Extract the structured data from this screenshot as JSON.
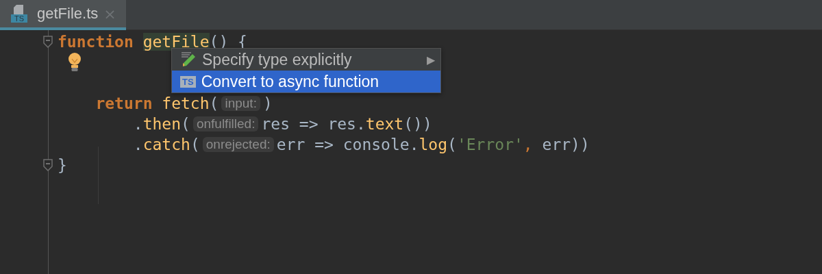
{
  "tabs": [
    {
      "label": "getFile.ts",
      "selected": true,
      "close": "×",
      "icon_text": "TS"
    }
  ],
  "code_lines": [
    {
      "fold": true,
      "tokens": [
        {
          "kind": "keyword",
          "text": "function"
        },
        {
          "kind": "fn-decl",
          "text": "getFile"
        },
        {
          "kind": "plain",
          "text": "() {"
        }
      ],
      "children": [
        {
          "kind": "blank",
          "bulb": true
        },
        {
          "kind": "blank"
        },
        {
          "tokens": [
            {
              "kind": "keyword",
              "text": "return"
            },
            {
              "kind": "fn",
              "text": "fetch"
            },
            {
              "kind": "plain",
              "text": "("
            },
            {
              "kind": "hint",
              "text": "input:"
            },
            {
              "kind": "plain",
              "text": ")"
            }
          ],
          "children": [
            {
              "tokens": [
                {
                  "kind": "plain",
                  "text": "."
                },
                {
                  "kind": "fn",
                  "text": "then"
                },
                {
                  "kind": "plain",
                  "text": "("
                },
                {
                  "kind": "hint",
                  "text": "onfulfilled:"
                },
                {
                  "kind": "plain",
                  "text": "res => res."
                },
                {
                  "kind": "fn",
                  "text": "text"
                },
                {
                  "kind": "plain",
                  "text": "())"
                }
              ]
            },
            {
              "tokens": [
                {
                  "kind": "plain",
                  "text": "."
                },
                {
                  "kind": "fn",
                  "text": "catch"
                },
                {
                  "kind": "plain",
                  "text": "("
                },
                {
                  "kind": "hint",
                  "text": "onrejected:"
                },
                {
                  "kind": "plain",
                  "text": "err => console."
                },
                {
                  "kind": "fn",
                  "text": "log"
                },
                {
                  "kind": "plain",
                  "text": "("
                },
                {
                  "kind": "string",
                  "text": "'Error'"
                },
                {
                  "kind": "punct",
                  "text": ","
                },
                {
                  "kind": "plain",
                  "text": " err))"
                }
              ]
            }
          ]
        }
      ]
    },
    {
      "fold": true,
      "tokens": [
        {
          "kind": "plain",
          "text": "}"
        }
      ]
    }
  ],
  "intention_menu": [
    {
      "kind": "edit",
      "label": "Specify type explicitly",
      "selected": false,
      "arrow": "▶"
    },
    {
      "kind": "ts",
      "label": "Convert to async function",
      "selected": true,
      "badge": "TS"
    }
  ]
}
